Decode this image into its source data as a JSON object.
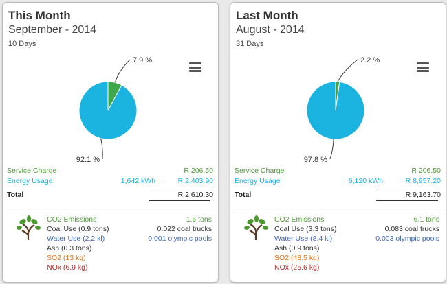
{
  "colors": {
    "service": "#4f9a3a",
    "energy": "#1bb3e0",
    "pie_small": "#3ea84a",
    "pie_big": "#1bb3e0"
  },
  "panels": [
    {
      "title": "This Month",
      "subtitle": "September - 2014",
      "days": "10 Days",
      "menu_icon": "hamburger-menu-icon",
      "chart_data": {
        "type": "pie",
        "slices": [
          {
            "label": "Service Charge",
            "value": 7.9,
            "text": "7.9 %"
          },
          {
            "label": "Energy Usage",
            "value": 92.1,
            "text": "92.1 %"
          }
        ]
      },
      "service_label": "Service Charge",
      "service_value": "R 206.50",
      "energy_label": "Energy Usage",
      "energy_kwh": "1,642 kWh",
      "energy_value": "R 2,403.90",
      "total_label": "Total",
      "total_value": "R 2,610.30",
      "emissions": {
        "co2_label": "CO2 Emissions",
        "co2_value": "1.6 tons",
        "coal_label": "Coal Use (0.9 tons)",
        "coal_value": "0.022 coal trucks",
        "water_label": "Water Use (2.2 kl)",
        "water_value": "0.001 olympic pools",
        "ash_label": "Ash (0.3 tons)",
        "so2_label": "SO2 (13 kg)",
        "nox_label": "NOx (6.9 kg)"
      }
    },
    {
      "title": "Last Month",
      "subtitle": "August - 2014",
      "days": "31 Days",
      "menu_icon": "hamburger-menu-icon",
      "chart_data": {
        "type": "pie",
        "slices": [
          {
            "label": "Service Charge",
            "value": 2.2,
            "text": "2.2 %"
          },
          {
            "label": "Energy Usage",
            "value": 97.8,
            "text": "97.8 %"
          }
        ]
      },
      "service_label": "Service Charge",
      "service_value": "R 206.50",
      "energy_label": "Energy Usage",
      "energy_kwh": "6,120 kWh",
      "energy_value": "R 8,957.20",
      "total_label": "Total",
      "total_value": "R 9,163.70",
      "emissions": {
        "co2_label": "CO2 Emissions",
        "co2_value": "6.1 tons",
        "coal_label": "Coal Use (3.3 tons)",
        "coal_value": "0.083 coal trucks",
        "water_label": "Water Use (8.4 kl)",
        "water_value": "0.003 olympic pools",
        "ash_label": "Ash (0.9 tons)",
        "so2_label": "SO2 (48.5 kg)",
        "nox_label": "NOx (25.6 kg)"
      }
    }
  ]
}
